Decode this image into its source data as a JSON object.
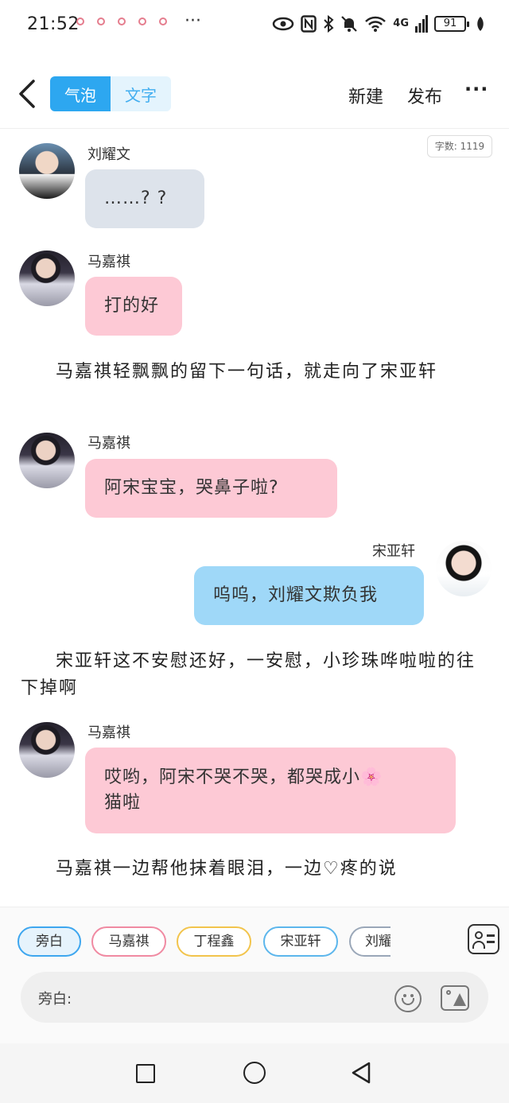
{
  "status_bar": {
    "time": "21:52",
    "more": "···",
    "network": "4G",
    "battery": "91"
  },
  "header": {
    "tab_bubble": "气泡",
    "tab_text": "文字",
    "new_label": "新建",
    "publish_label": "发布",
    "more_label": "···"
  },
  "word_count": "字数: 1119",
  "messages": [
    {
      "speaker": "刘耀文",
      "text": "……? ?",
      "style": "gray",
      "side": "left"
    },
    {
      "speaker": "马嘉祺",
      "text": "打的好",
      "style": "pink",
      "side": "left"
    },
    {
      "narration": "马嘉祺轻飘飘的留下一句话，就走向了宋亚轩"
    },
    {
      "speaker": "马嘉祺",
      "text": "阿宋宝宝，哭鼻子啦?",
      "style": "pink",
      "side": "left"
    },
    {
      "speaker": "宋亚轩",
      "text": "呜呜，刘耀文欺负我",
      "style": "blue",
      "side": "right"
    },
    {
      "narration": "宋亚轩这不安慰还好，一安慰，小珍珠哗啦啦的往下掉啊"
    },
    {
      "speaker": "马嘉祺",
      "text_line1": "哎哟，阿宋不哭不哭，都哭成小🌸",
      "text_line2": "猫啦",
      "style": "pink",
      "side": "left"
    },
    {
      "narration": "马嘉祺一边帮他抹着眼泪，一边♡疼的说"
    }
  ],
  "characters": [
    "旁白",
    "马嘉祺",
    "丁程鑫",
    "宋亚轩",
    "刘耀"
  ],
  "input": {
    "label": "旁白:"
  },
  "colors": {
    "accent": "#2da7f0",
    "bubble_gray": "#dde3eb",
    "bubble_pink": "#fdc9d5",
    "bubble_blue": "#9fd8f8"
  }
}
